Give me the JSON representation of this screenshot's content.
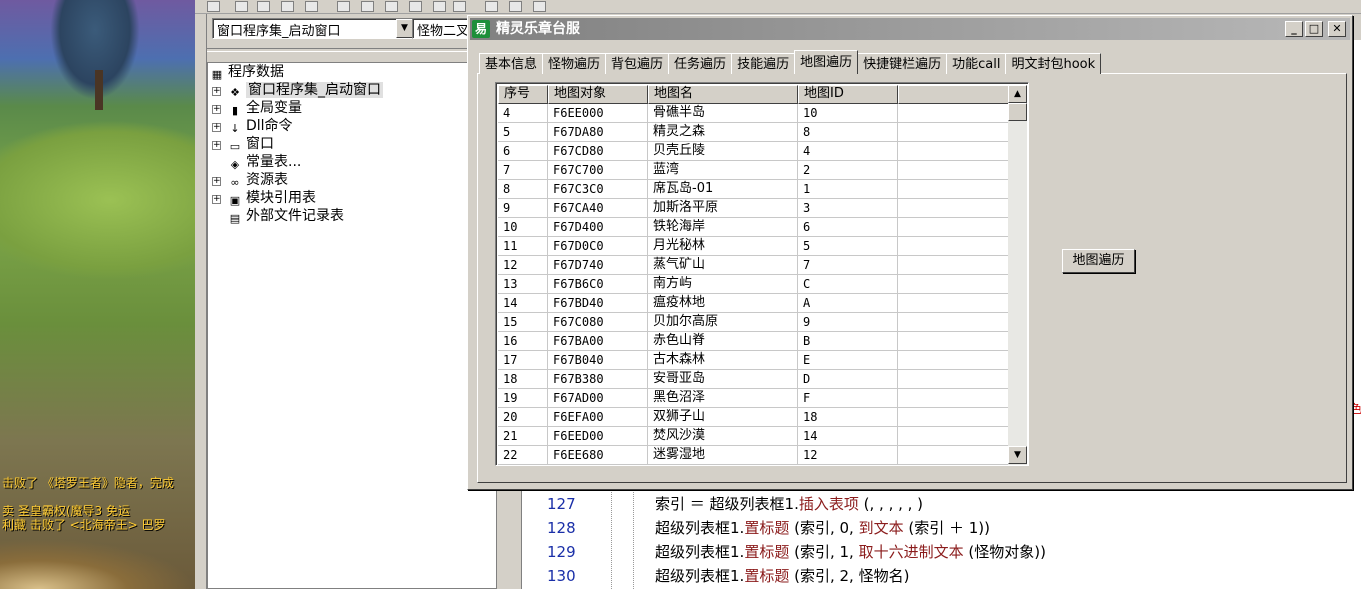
{
  "game": {
    "messages": [
      "击败了 《塔罗王者》隐者，完成",
      "卖 圣皇霸权(魔导3  免运",
      "利藏 击败了 <北海帝王> 巴罗"
    ]
  },
  "ide": {
    "combo_left": "窗口程序集_启动窗口",
    "combo_right": "怪物二叉",
    "tree": [
      {
        "label": "程序数据",
        "icon": "data-icon"
      },
      {
        "label": "窗口程序集_启动窗口",
        "icon": "stack-icon"
      },
      {
        "label": "全局变量",
        "icon": "jar-icon"
      },
      {
        "label": "Dll命令",
        "icon": "dll-icon"
      },
      {
        "label": "窗口",
        "icon": "window-icon"
      },
      {
        "label": "常量表...",
        "icon": "const-icon"
      },
      {
        "label": "资源表",
        "icon": "resource-icon"
      },
      {
        "label": "模块引用表",
        "icon": "module-icon"
      },
      {
        "label": "外部文件记录表",
        "icon": "file-icon"
      }
    ],
    "code": [
      {
        "num": "127",
        "pre": "索引 ＝ 超级列表框1.",
        "kw": "插入表项",
        "post": " (, , , , , )"
      },
      {
        "num": "128",
        "pre": "超级列表框1.",
        "kw": "置标题",
        "post": " (索引, 0, ",
        "kw2": "到文本",
        "post2": " (索引 ＋ 1))"
      },
      {
        "num": "129",
        "pre": "超级列表框1.",
        "kw": "置标题",
        "post": " (索引, 1, ",
        "kw2": "取十六进制文本",
        "post2": " (怪物对象))"
      },
      {
        "num": "130",
        "pre": "超级列表框1.",
        "kw": "置标题",
        "post": " (索引, 2, 怪物名)"
      }
    ]
  },
  "window": {
    "title": "精灵乐章台服",
    "icon_glyph": "易",
    "minimize": "_",
    "maximize": "□",
    "close": "✕",
    "tabs": [
      "基本信息",
      "怪物遍历",
      "背包遍历",
      "任务遍历",
      "技能遍历",
      "地图遍历",
      "快捷键栏遍历",
      "功能call",
      "明文封包hook"
    ],
    "active_tab": 5,
    "button_label": "地图遍历"
  },
  "table": {
    "columns": [
      "序号",
      "地图对象",
      "地图名",
      "地图ID"
    ],
    "rows": [
      [
        "4",
        "F6EE000",
        "骨礁半岛",
        "10"
      ],
      [
        "5",
        "F67DA80",
        "精灵之森",
        "8"
      ],
      [
        "6",
        "F67CD80",
        "贝壳丘陵",
        "4"
      ],
      [
        "7",
        "F67C700",
        "蓝湾",
        "2"
      ],
      [
        "8",
        "F67C3C0",
        "席瓦岛-01",
        "1"
      ],
      [
        "9",
        "F67CA40",
        "加斯洛平原",
        "3"
      ],
      [
        "10",
        "F67D400",
        "铁轮海岸",
        "6"
      ],
      [
        "11",
        "F67D0C0",
        "月光秘林",
        "5"
      ],
      [
        "12",
        "F67D740",
        "蒸气矿山",
        "7"
      ],
      [
        "13",
        "F67B6C0",
        "南方屿",
        "C"
      ],
      [
        "14",
        "F67BD40",
        "瘟疫林地",
        "A"
      ],
      [
        "15",
        "F67C080",
        "贝加尔高原",
        "9"
      ],
      [
        "16",
        "F67BA00",
        "赤色山脊",
        "B"
      ],
      [
        "17",
        "F67B040",
        "古木森林",
        "E"
      ],
      [
        "18",
        "F67B380",
        "安哥亚岛",
        "D"
      ],
      [
        "19",
        "F67AD00",
        "黑色沼泽",
        "F"
      ],
      [
        "20",
        "F6EFA00",
        "双狮子山",
        "18"
      ],
      [
        "21",
        "F6EED00",
        "焚风沙漠",
        "14"
      ],
      [
        "22",
        "F6EE680",
        "迷雾湿地",
        "12"
      ]
    ]
  }
}
